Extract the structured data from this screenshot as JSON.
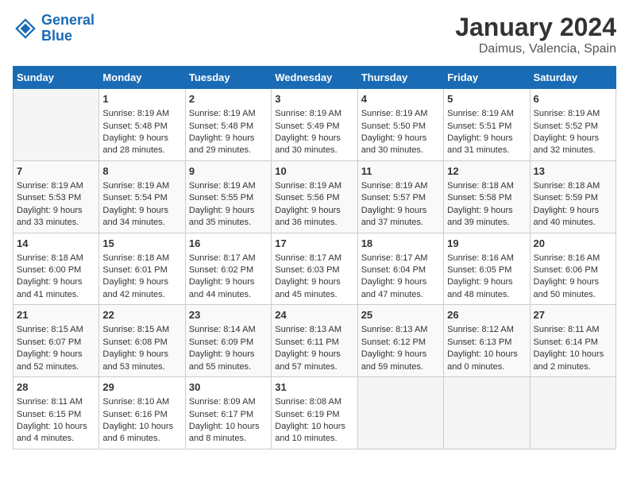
{
  "logo": {
    "line1": "General",
    "line2": "Blue"
  },
  "title": "January 2024",
  "subtitle": "Daimus, Valencia, Spain",
  "days_of_week": [
    "Sunday",
    "Monday",
    "Tuesday",
    "Wednesday",
    "Thursday",
    "Friday",
    "Saturday"
  ],
  "weeks": [
    [
      {
        "day": "",
        "sunrise": "",
        "sunset": "",
        "daylight": ""
      },
      {
        "day": "1",
        "sunrise": "Sunrise: 8:19 AM",
        "sunset": "Sunset: 5:48 PM",
        "daylight": "Daylight: 9 hours and 28 minutes."
      },
      {
        "day": "2",
        "sunrise": "Sunrise: 8:19 AM",
        "sunset": "Sunset: 5:48 PM",
        "daylight": "Daylight: 9 hours and 29 minutes."
      },
      {
        "day": "3",
        "sunrise": "Sunrise: 8:19 AM",
        "sunset": "Sunset: 5:49 PM",
        "daylight": "Daylight: 9 hours and 30 minutes."
      },
      {
        "day": "4",
        "sunrise": "Sunrise: 8:19 AM",
        "sunset": "Sunset: 5:50 PM",
        "daylight": "Daylight: 9 hours and 30 minutes."
      },
      {
        "day": "5",
        "sunrise": "Sunrise: 8:19 AM",
        "sunset": "Sunset: 5:51 PM",
        "daylight": "Daylight: 9 hours and 31 minutes."
      },
      {
        "day": "6",
        "sunrise": "Sunrise: 8:19 AM",
        "sunset": "Sunset: 5:52 PM",
        "daylight": "Daylight: 9 hours and 32 minutes."
      }
    ],
    [
      {
        "day": "7",
        "sunrise": "Sunrise: 8:19 AM",
        "sunset": "Sunset: 5:53 PM",
        "daylight": "Daylight: 9 hours and 33 minutes."
      },
      {
        "day": "8",
        "sunrise": "Sunrise: 8:19 AM",
        "sunset": "Sunset: 5:54 PM",
        "daylight": "Daylight: 9 hours and 34 minutes."
      },
      {
        "day": "9",
        "sunrise": "Sunrise: 8:19 AM",
        "sunset": "Sunset: 5:55 PM",
        "daylight": "Daylight: 9 hours and 35 minutes."
      },
      {
        "day": "10",
        "sunrise": "Sunrise: 8:19 AM",
        "sunset": "Sunset: 5:56 PM",
        "daylight": "Daylight: 9 hours and 36 minutes."
      },
      {
        "day": "11",
        "sunrise": "Sunrise: 8:19 AM",
        "sunset": "Sunset: 5:57 PM",
        "daylight": "Daylight: 9 hours and 37 minutes."
      },
      {
        "day": "12",
        "sunrise": "Sunrise: 8:18 AM",
        "sunset": "Sunset: 5:58 PM",
        "daylight": "Daylight: 9 hours and 39 minutes."
      },
      {
        "day": "13",
        "sunrise": "Sunrise: 8:18 AM",
        "sunset": "Sunset: 5:59 PM",
        "daylight": "Daylight: 9 hours and 40 minutes."
      }
    ],
    [
      {
        "day": "14",
        "sunrise": "Sunrise: 8:18 AM",
        "sunset": "Sunset: 6:00 PM",
        "daylight": "Daylight: 9 hours and 41 minutes."
      },
      {
        "day": "15",
        "sunrise": "Sunrise: 8:18 AM",
        "sunset": "Sunset: 6:01 PM",
        "daylight": "Daylight: 9 hours and 42 minutes."
      },
      {
        "day": "16",
        "sunrise": "Sunrise: 8:17 AM",
        "sunset": "Sunset: 6:02 PM",
        "daylight": "Daylight: 9 hours and 44 minutes."
      },
      {
        "day": "17",
        "sunrise": "Sunrise: 8:17 AM",
        "sunset": "Sunset: 6:03 PM",
        "daylight": "Daylight: 9 hours and 45 minutes."
      },
      {
        "day": "18",
        "sunrise": "Sunrise: 8:17 AM",
        "sunset": "Sunset: 6:04 PM",
        "daylight": "Daylight: 9 hours and 47 minutes."
      },
      {
        "day": "19",
        "sunrise": "Sunrise: 8:16 AM",
        "sunset": "Sunset: 6:05 PM",
        "daylight": "Daylight: 9 hours and 48 minutes."
      },
      {
        "day": "20",
        "sunrise": "Sunrise: 8:16 AM",
        "sunset": "Sunset: 6:06 PM",
        "daylight": "Daylight: 9 hours and 50 minutes."
      }
    ],
    [
      {
        "day": "21",
        "sunrise": "Sunrise: 8:15 AM",
        "sunset": "Sunset: 6:07 PM",
        "daylight": "Daylight: 9 hours and 52 minutes."
      },
      {
        "day": "22",
        "sunrise": "Sunrise: 8:15 AM",
        "sunset": "Sunset: 6:08 PM",
        "daylight": "Daylight: 9 hours and 53 minutes."
      },
      {
        "day": "23",
        "sunrise": "Sunrise: 8:14 AM",
        "sunset": "Sunset: 6:09 PM",
        "daylight": "Daylight: 9 hours and 55 minutes."
      },
      {
        "day": "24",
        "sunrise": "Sunrise: 8:13 AM",
        "sunset": "Sunset: 6:11 PM",
        "daylight": "Daylight: 9 hours and 57 minutes."
      },
      {
        "day": "25",
        "sunrise": "Sunrise: 8:13 AM",
        "sunset": "Sunset: 6:12 PM",
        "daylight": "Daylight: 9 hours and 59 minutes."
      },
      {
        "day": "26",
        "sunrise": "Sunrise: 8:12 AM",
        "sunset": "Sunset: 6:13 PM",
        "daylight": "Daylight: 10 hours and 0 minutes."
      },
      {
        "day": "27",
        "sunrise": "Sunrise: 8:11 AM",
        "sunset": "Sunset: 6:14 PM",
        "daylight": "Daylight: 10 hours and 2 minutes."
      }
    ],
    [
      {
        "day": "28",
        "sunrise": "Sunrise: 8:11 AM",
        "sunset": "Sunset: 6:15 PM",
        "daylight": "Daylight: 10 hours and 4 minutes."
      },
      {
        "day": "29",
        "sunrise": "Sunrise: 8:10 AM",
        "sunset": "Sunset: 6:16 PM",
        "daylight": "Daylight: 10 hours and 6 minutes."
      },
      {
        "day": "30",
        "sunrise": "Sunrise: 8:09 AM",
        "sunset": "Sunset: 6:17 PM",
        "daylight": "Daylight: 10 hours and 8 minutes."
      },
      {
        "day": "31",
        "sunrise": "Sunrise: 8:08 AM",
        "sunset": "Sunset: 6:19 PM",
        "daylight": "Daylight: 10 hours and 10 minutes."
      },
      {
        "day": "",
        "sunrise": "",
        "sunset": "",
        "daylight": ""
      },
      {
        "day": "",
        "sunrise": "",
        "sunset": "",
        "daylight": ""
      },
      {
        "day": "",
        "sunrise": "",
        "sunset": "",
        "daylight": ""
      }
    ]
  ]
}
